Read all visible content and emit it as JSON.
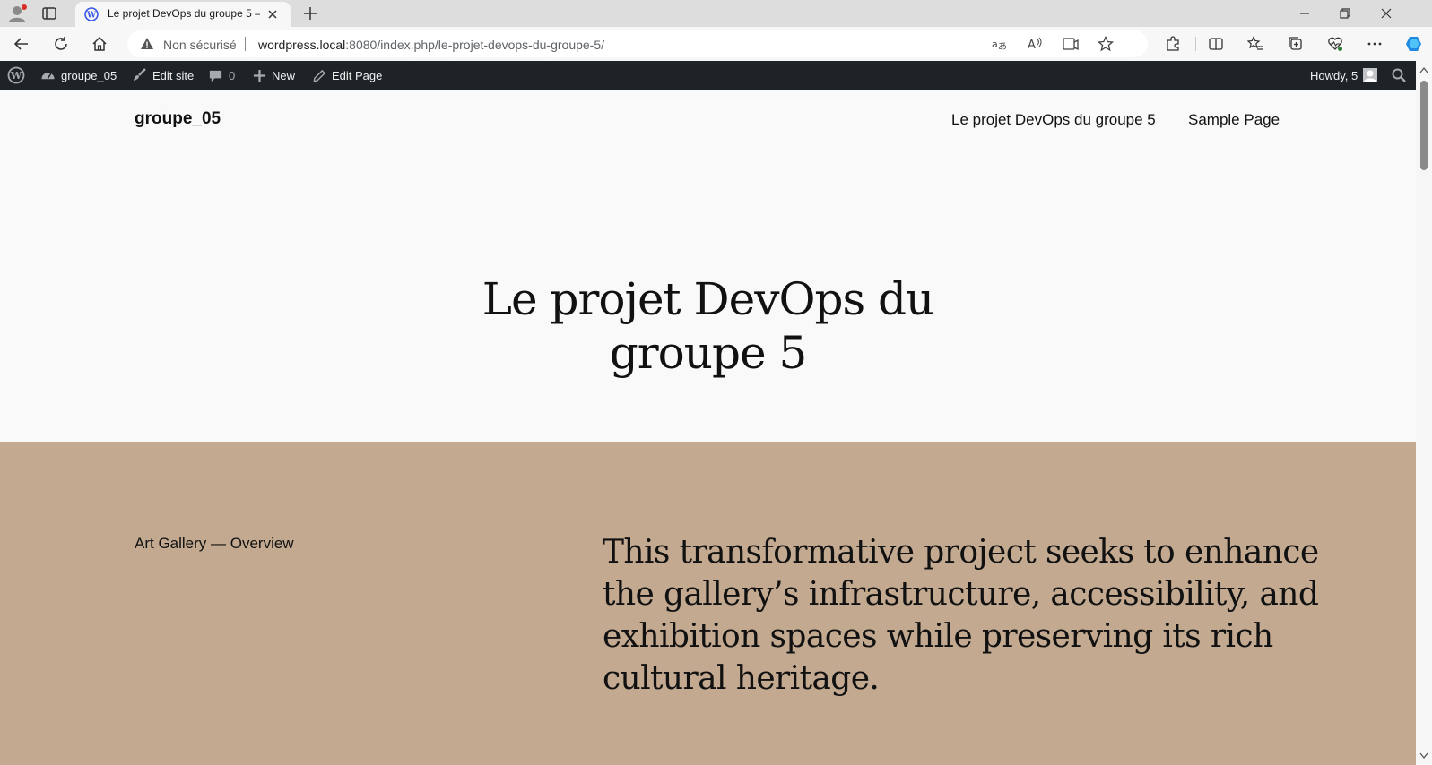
{
  "browser": {
    "tab": {
      "title": "Le projet DevOps du groupe 5 –"
    },
    "address": {
      "security_label": "Non sécurisé",
      "url_host": "wordpress.local",
      "url_rest": ":8080/index.php/le-projet-devops-du-groupe-5/"
    },
    "icons": {
      "profile": "profile-icon",
      "tab_actions": "tab-actions-icon",
      "favicon": "wordpress-icon",
      "close_tab": "close-icon",
      "new_tab": "plus-icon",
      "minimize": "minimize-icon",
      "restore": "restore-icon",
      "close_window": "close-icon",
      "back": "back-arrow-icon",
      "refresh": "refresh-icon",
      "home": "home-icon",
      "warning": "warning-icon",
      "translate": "translate-icon",
      "read_aloud": "read-aloud-icon",
      "immersive_reader": "immersive-reader-icon",
      "favorite": "star-icon",
      "extensions": "puzzle-icon",
      "split_screen": "split-screen-icon",
      "favorites": "favorites-icon",
      "collections": "collections-icon",
      "performance": "heart-pulse-icon",
      "more": "more-icon",
      "copilot": "copilot-icon"
    }
  },
  "adminbar": {
    "site_name": "groupe_05",
    "edit_site": "Edit site",
    "comments_count": "0",
    "new_label": "New",
    "edit_page": "Edit Page",
    "howdy": "Howdy, 5"
  },
  "site": {
    "title": "groupe_05",
    "nav": [
      "Le projet DevOps du groupe 5",
      "Sample Page"
    ]
  },
  "page": {
    "title_lines": [
      "Le projet DevOps du",
      "groupe 5"
    ],
    "overview_label": "Art Gallery — Overview",
    "lead_lines": [
      "This transformative project seeks to enhance",
      "the gallery’s infrastructure, accessibility, and",
      "exhibition spaces while preserving its rich",
      "cultural heritage."
    ]
  },
  "colors": {
    "admin_bar": "#1d2327",
    "tan_section": "#c2a990",
    "page_background": "#f9f9f9",
    "text": "#111111"
  }
}
